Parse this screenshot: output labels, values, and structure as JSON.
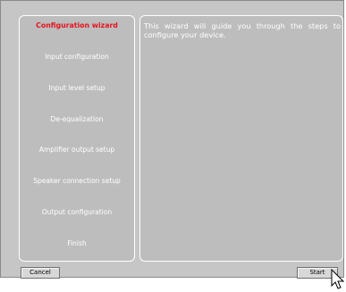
{
  "steps": [
    {
      "label": "Configuration wizard",
      "active": true
    },
    {
      "label": "Input configuration"
    },
    {
      "label": "Input level setup"
    },
    {
      "label": "De-equalization"
    },
    {
      "label": "Amplifier output setup"
    },
    {
      "label": "Speaker connection setup"
    },
    {
      "label": "Output configuration"
    },
    {
      "label": "Finish"
    }
  ],
  "content": {
    "description": "This wizard will guide you through the steps to configure your device."
  },
  "buttons": {
    "cancel_label": "Cancel",
    "start_label": "Start"
  },
  "colors": {
    "active_step": "#e4141e",
    "panel_bg": "#bdbdbd",
    "dialog_bg": "#c6c6c6"
  }
}
